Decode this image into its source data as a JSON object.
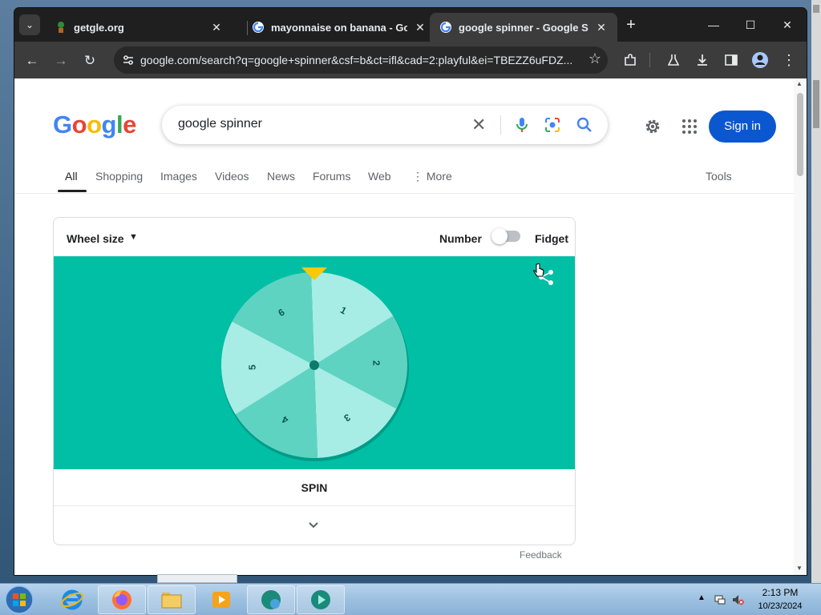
{
  "browser": {
    "tabs": [
      {
        "title": "getgle.org",
        "icon": "plant-favicon-icon",
        "active": false
      },
      {
        "title": "mayonnaise on banana - Goog",
        "icon": "google-favicon-icon",
        "active": false
      },
      {
        "title": "google spinner - Google Searc",
        "icon": "google-favicon-icon",
        "active": true
      }
    ],
    "tab_close": "✕",
    "new_tab": "+",
    "window": {
      "minimize": "—",
      "maximize": "☐",
      "close": "✕"
    },
    "url": "google.com/search?q=google+spinner&csf=b&ct=ifl&cad=2:playful&ei=TBEZZ6uFDZ...",
    "nav": {
      "back": "←",
      "forward": "→",
      "reload": "↻"
    },
    "star": "☆"
  },
  "google": {
    "logo": [
      "G",
      "o",
      "o",
      "g",
      "l",
      "e"
    ],
    "logo_colors": [
      "#4285F4",
      "#EA4335",
      "#FBBC05",
      "#4285F4",
      "#34A853",
      "#EA4335"
    ],
    "query": "google spinner",
    "sign_in": "Sign in",
    "tabs": [
      "All",
      "Shopping",
      "Images",
      "Videos",
      "News",
      "Forums",
      "Web",
      "More"
    ],
    "tools": "Tools",
    "more_prefix": "⋮"
  },
  "spinner": {
    "wheel_size_label": "Wheel size",
    "number_label": "Number",
    "fidget_label": "Fidget",
    "toggle_on": false,
    "segments": [
      "1",
      "2",
      "3",
      "4",
      "5",
      "6"
    ],
    "colors": {
      "teal": "#00BFA5",
      "light": "#A7EDE5",
      "mid": "#5FD3C2",
      "pointer": "#F9C80E",
      "hub": "#0D7A6B"
    },
    "spin_label": "SPIN",
    "feedback": "Feedback"
  },
  "taskbar": {
    "time": "2:13 PM",
    "date": "10/23/2024"
  }
}
